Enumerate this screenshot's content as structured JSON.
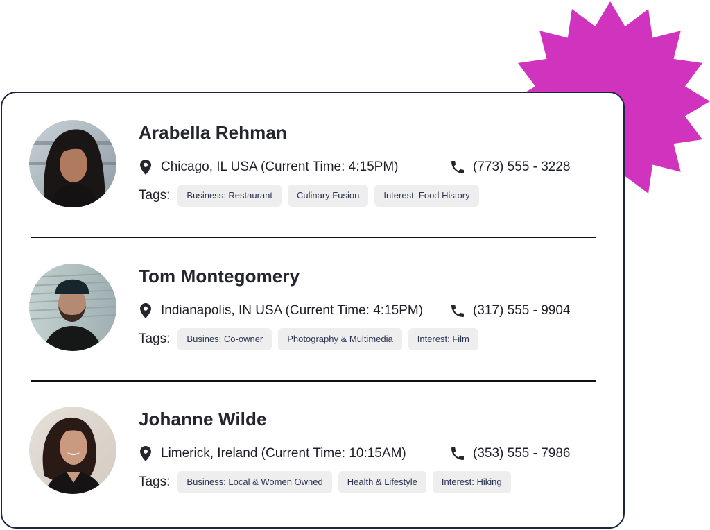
{
  "colors": {
    "accent_starburst": "#d033be",
    "card_border": "#1b2540",
    "tag_background": "#eeeeef",
    "tag_text": "#2a3350",
    "divider": "#111111"
  },
  "tags_label": "Tags:",
  "contacts": [
    {
      "name": "Arabella Rehman",
      "location": "Chicago, IL USA (Current Time: 4:15PM)",
      "phone": "(773) 555 - 3228",
      "tags": [
        "Business: Restaurant",
        "Culinary Fusion",
        "Interest: Food History"
      ]
    },
    {
      "name": "Tom Montegomery",
      "location": "Indianapolis, IN USA (Current Time: 4:15PM)",
      "phone": "(317) 555 - 9904",
      "tags": [
        "Busines: Co-owner",
        "Photography & Multimedia",
        "Interest: Film"
      ]
    },
    {
      "name": "Johanne Wilde",
      "location": "Limerick, Ireland (Current Time: 10:15AM)",
      "phone": "(353) 555 - 7986",
      "tags": [
        "Business: Local & Women Owned",
        "Health & Lifestyle",
        "Interest: Hiking"
      ]
    }
  ],
  "icons": {
    "location": "map-pin-icon",
    "phone": "phone-icon",
    "decoration": "starburst-icon"
  }
}
